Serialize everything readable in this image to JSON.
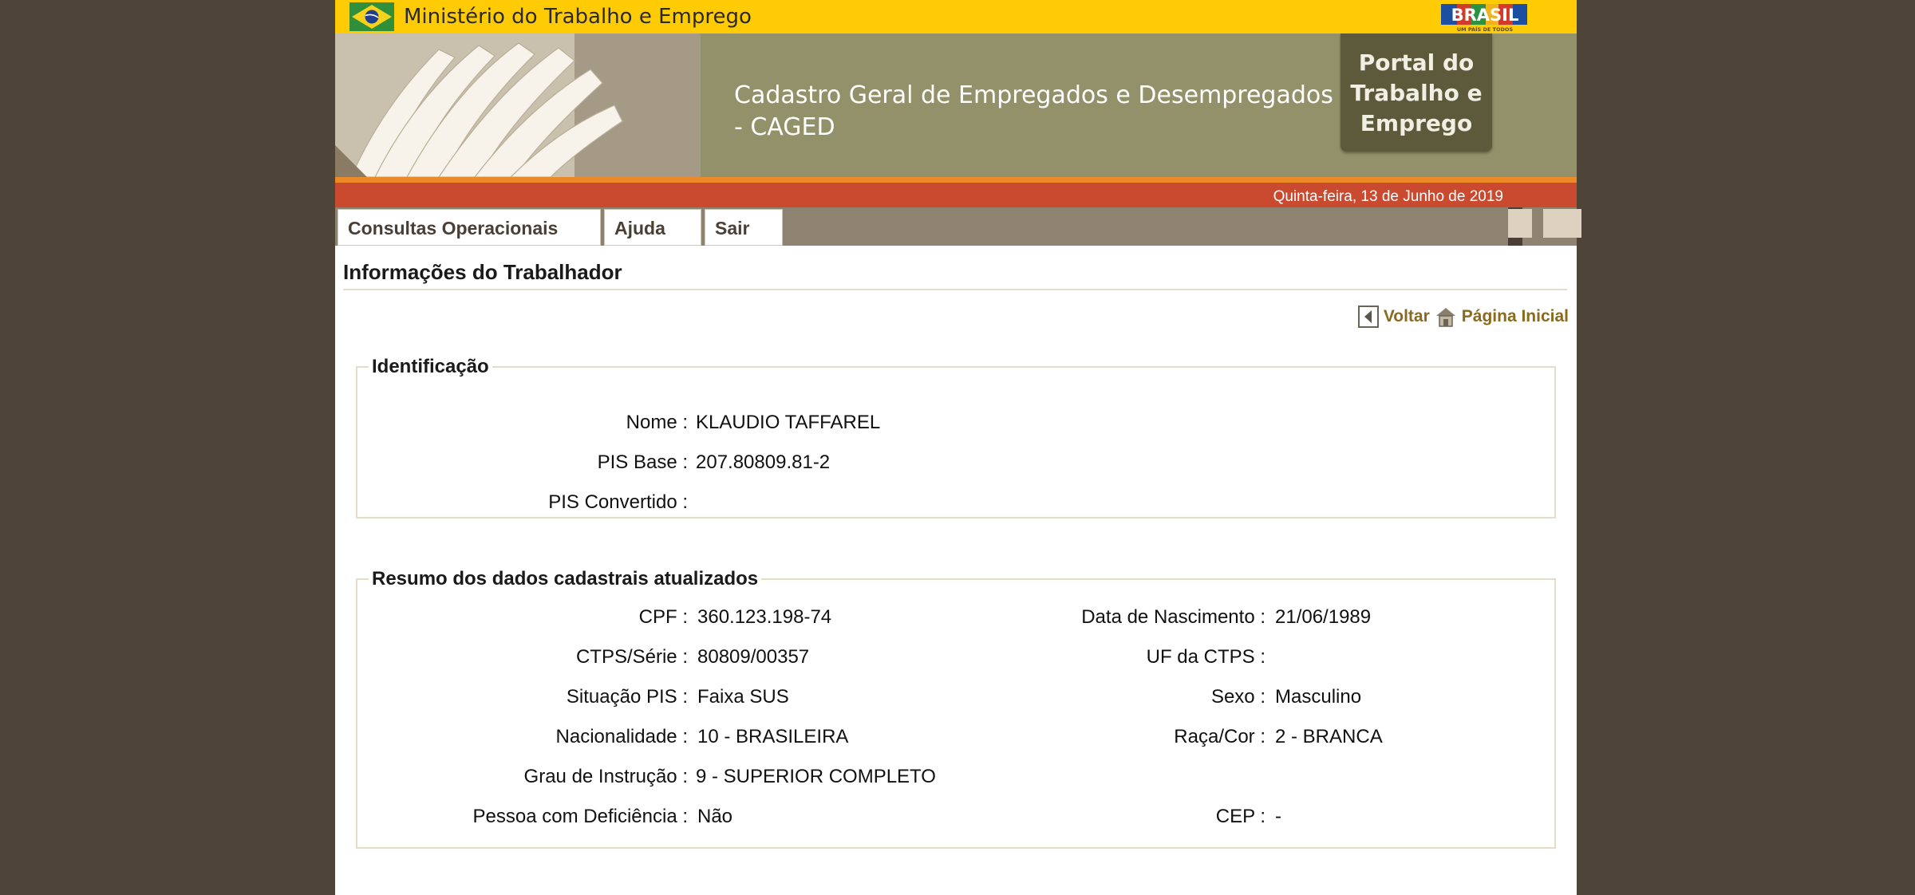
{
  "header": {
    "ministry": "Ministério do Trabalho e Emprego",
    "system_title": "Cadastro Geral de Empregados e Desempregados - CAGED",
    "portal_label": [
      "Portal do",
      "Trabalho e",
      "Emprego"
    ],
    "brasil_logo_text": "BRASIL",
    "brasil_logo_slogan": "UM PAÍS DE TODOS",
    "date": "Quinta-feira, 13 de Junho de 2019"
  },
  "menu": {
    "items": [
      "Consultas Operacionais",
      "Ajuda",
      "Sair"
    ]
  },
  "page": {
    "title": "Informações do Trabalhador",
    "back_label": "Voltar",
    "home_label": "Página Inicial"
  },
  "identificacao": {
    "legend": "Identificação",
    "fields": [
      {
        "label": "Nome :",
        "value": "KLAUDIO TAFFAREL"
      },
      {
        "label": "PIS Base :",
        "value": "207.80809.81-2"
      },
      {
        "label": "PIS Convertido :",
        "value": ""
      }
    ]
  },
  "resumo": {
    "legend": "Resumo dos dados cadastrais atualizados",
    "left": [
      {
        "label": "CPF :",
        "value": "360.123.198-74"
      },
      {
        "label": "CTPS/Série :",
        "value": "80809/00357"
      },
      {
        "label": "Situação PIS :",
        "value": "Faixa SUS"
      },
      {
        "label": "Nacionalidade :",
        "value": "10 - BRASILEIRA"
      },
      {
        "label": "Grau de Instrução :",
        "value": "9 - SUPERIOR COMPLETO"
      },
      {
        "label": "Pessoa com Deficiência :",
        "value": "Não"
      }
    ],
    "right": [
      {
        "label": "Data de Nascimento :",
        "value": "21/06/1989"
      },
      {
        "label": "UF da CTPS :",
        "value": ""
      },
      {
        "label": "Sexo :",
        "value": "Masculino"
      },
      {
        "label": "Raça/Cor :",
        "value": "2 - BRANCA"
      },
      {
        "label": "",
        "value": ""
      },
      {
        "label": "CEP :",
        "value": "-"
      }
    ]
  },
  "colors": {
    "gov_yellow": "#ffcb05",
    "banner_olive": "#939169",
    "orange_bar": "#c94a2e",
    "menu_bar": "#8e8370",
    "link_gold": "#8a6a1e"
  }
}
